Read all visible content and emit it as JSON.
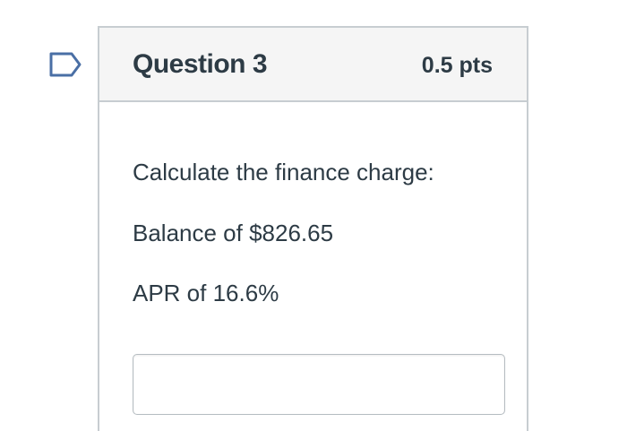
{
  "question": {
    "title": "Question 3",
    "points": "0.5 pts",
    "flag_icon": "bookmark-flag-icon",
    "body_lines": [
      "Calculate the finance charge:",
      "Balance of $826.65",
      "APR of 16.6%"
    ],
    "answer": {
      "value": "",
      "placeholder": ""
    }
  },
  "colors": {
    "header_bg": "#f5f5f5",
    "border": "#c7cdd1",
    "text": "#2d3b45",
    "flag": "#4a6fa5"
  }
}
